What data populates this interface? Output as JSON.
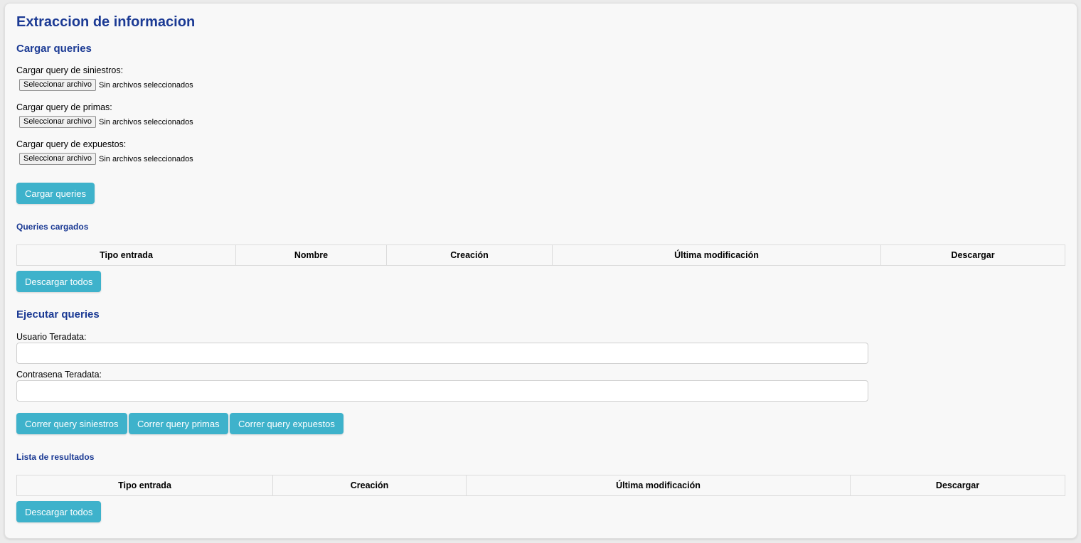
{
  "page": {
    "title": "Extraccion de informacion"
  },
  "load": {
    "heading": "Cargar queries",
    "fields": [
      {
        "label": "Cargar query de siniestros:",
        "button": "Seleccionar archivo",
        "status": "Sin archivos seleccionados"
      },
      {
        "label": "Cargar query de primas:",
        "button": "Seleccionar archivo",
        "status": "Sin archivos seleccionados"
      },
      {
        "label": "Cargar query de expuestos:",
        "button": "Seleccionar archivo",
        "status": "Sin archivos seleccionados"
      }
    ],
    "submit_label": "Cargar queries"
  },
  "loaded": {
    "heading": "Queries cargados",
    "columns": [
      "Tipo entrada",
      "Nombre",
      "Creación",
      "Última modificación",
      "Descargar"
    ],
    "download_all_label": "Descargar todos"
  },
  "execute": {
    "heading": "Ejecutar queries",
    "user_label": "Usuario Teradata:",
    "user_value": "",
    "password_label": "Contrasena Teradata:",
    "password_value": "",
    "buttons": [
      "Correr query siniestros",
      "Correr query primas",
      "Correr query expuestos"
    ]
  },
  "results": {
    "heading": "Lista de resultados",
    "columns": [
      "Tipo entrada",
      "Creación",
      "Última modificación",
      "Descargar"
    ],
    "download_all_label": "Descargar todos"
  },
  "colors": {
    "heading": "#1b3a94",
    "button": "#3eb2cb"
  }
}
